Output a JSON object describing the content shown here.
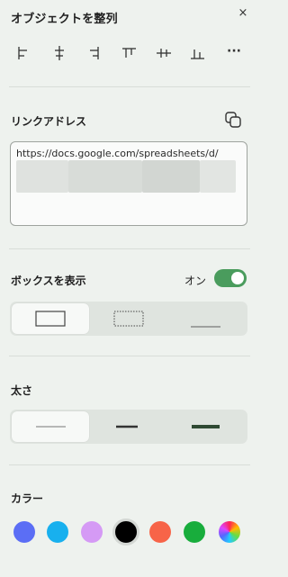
{
  "header": {
    "title": "オブジェクトを整列",
    "close_label": "×"
  },
  "align": {
    "buttons": [
      {
        "icon": "align-left-icon"
      },
      {
        "icon": "align-horizontal-center-icon"
      },
      {
        "icon": "align-right-icon"
      },
      {
        "icon": "align-top-icon"
      },
      {
        "icon": "align-vertical-center-icon"
      },
      {
        "icon": "align-bottom-icon"
      }
    ],
    "more_label": "···"
  },
  "link": {
    "title": "リンクアドレス",
    "url": "https://docs.google.com/spreadsheets/d/",
    "copy_icon": "copy-icon"
  },
  "box": {
    "title": "ボックスを表示",
    "toggle_label": "オン",
    "toggle_on": true,
    "styles": [
      {
        "name": "solid-border",
        "selected": true
      },
      {
        "name": "dotted-border",
        "selected": false
      },
      {
        "name": "underline",
        "selected": false
      }
    ]
  },
  "thickness": {
    "title": "太さ",
    "options": [
      {
        "name": "thin",
        "selected": true
      },
      {
        "name": "medium",
        "selected": false
      },
      {
        "name": "thick",
        "selected": false
      }
    ]
  },
  "color": {
    "title": "カラー",
    "swatches": [
      "#5b6ef5",
      "#18b0ee",
      "#d59af5",
      "#000000",
      "#f76448",
      "#18ad3c",
      "rainbow"
    ],
    "selected_index": 3
  },
  "colors": {
    "accent": "#4a9c5d",
    "panel_bg": "#eef2ee"
  }
}
